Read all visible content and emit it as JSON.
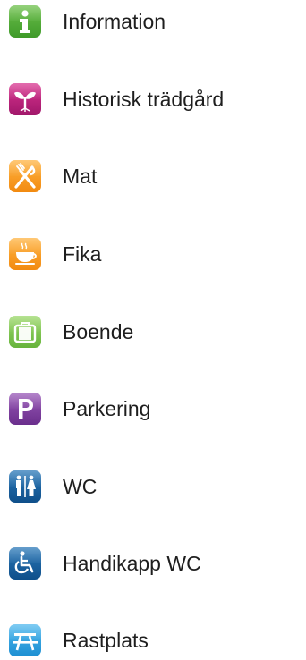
{
  "legend": {
    "items": [
      {
        "label": "Information",
        "icon": "information-icon",
        "color": "#4faa35"
      },
      {
        "label": "Historisk trädgård",
        "icon": "sprout-icon",
        "color": "#c0207d"
      },
      {
        "label": "Mat",
        "icon": "fork-knife-icon",
        "color": "#f7a12a"
      },
      {
        "label": "Fika",
        "icon": "coffee-cup-icon",
        "color": "#f7a12a"
      },
      {
        "label": "Boende",
        "icon": "suitcase-icon",
        "color": "#7cc44e"
      },
      {
        "label": "Parkering",
        "icon": "parking-icon",
        "color": "#7d3fa0",
        "glyph": "P"
      },
      {
        "label": "WC",
        "icon": "toilet-icon",
        "color": "#1a5f9e"
      },
      {
        "label": "Handikapp WC",
        "icon": "wheelchair-icon",
        "color": "#1a5f9e"
      },
      {
        "label": "Rastplats",
        "icon": "picnic-table-icon",
        "color": "#2fa3e0"
      }
    ]
  }
}
